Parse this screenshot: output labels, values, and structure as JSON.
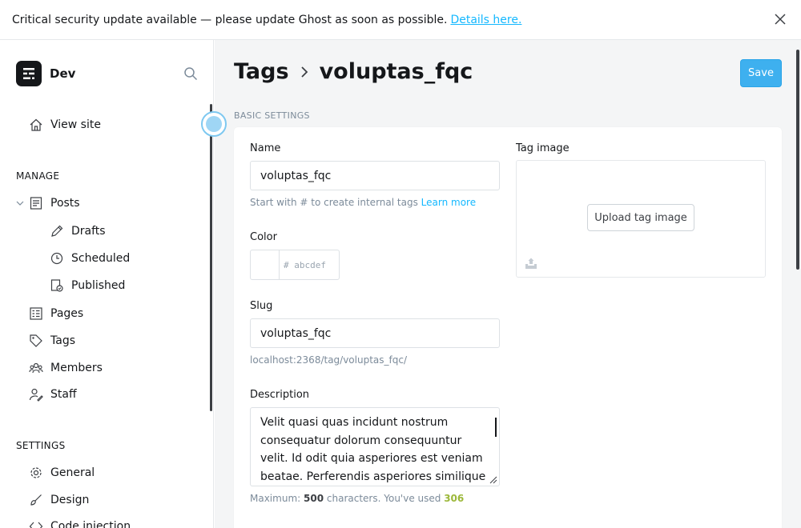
{
  "banner": {
    "message": "Critical security update available — please update Ghost as soon as possible.",
    "link": "Details here."
  },
  "sidebar": {
    "brand": "Dev",
    "view_site": "View site",
    "manage_label": "MANAGE",
    "posts": "Posts",
    "drafts": "Drafts",
    "scheduled": "Scheduled",
    "published": "Published",
    "pages": "Pages",
    "tags": "Tags",
    "members": "Members",
    "staff": "Staff",
    "settings_label": "SETTINGS",
    "general": "General",
    "design": "Design",
    "code_injection": "Code injection"
  },
  "header": {
    "parent": "Tags",
    "current": "voluptas_fqc",
    "save": "Save"
  },
  "form": {
    "section": "BASIC SETTINGS",
    "name_label": "Name",
    "name_value": "voluptas_fqc",
    "name_hint": "Start with # to create internal tags",
    "learn_more": "Learn more",
    "color_label": "Color",
    "color_placeholder": "# abcdef",
    "slug_label": "Slug",
    "slug_value": "voluptas_fqc",
    "slug_url": "localhost:2368/tag/voluptas_fqc/",
    "description_label": "Description",
    "description_value": "Velit quasi quas incidunt nostrum consequatur dolorum consequuntur velit. Id odit quia asperiores est veniam beatae. Perferendis asperiores similique veritatis",
    "counter_prefix": "Maximum:",
    "counter_max": "500",
    "counter_mid": "characters. You've used",
    "counter_used": "306",
    "tag_image_label": "Tag image",
    "upload_label": "Upload tag image"
  }
}
